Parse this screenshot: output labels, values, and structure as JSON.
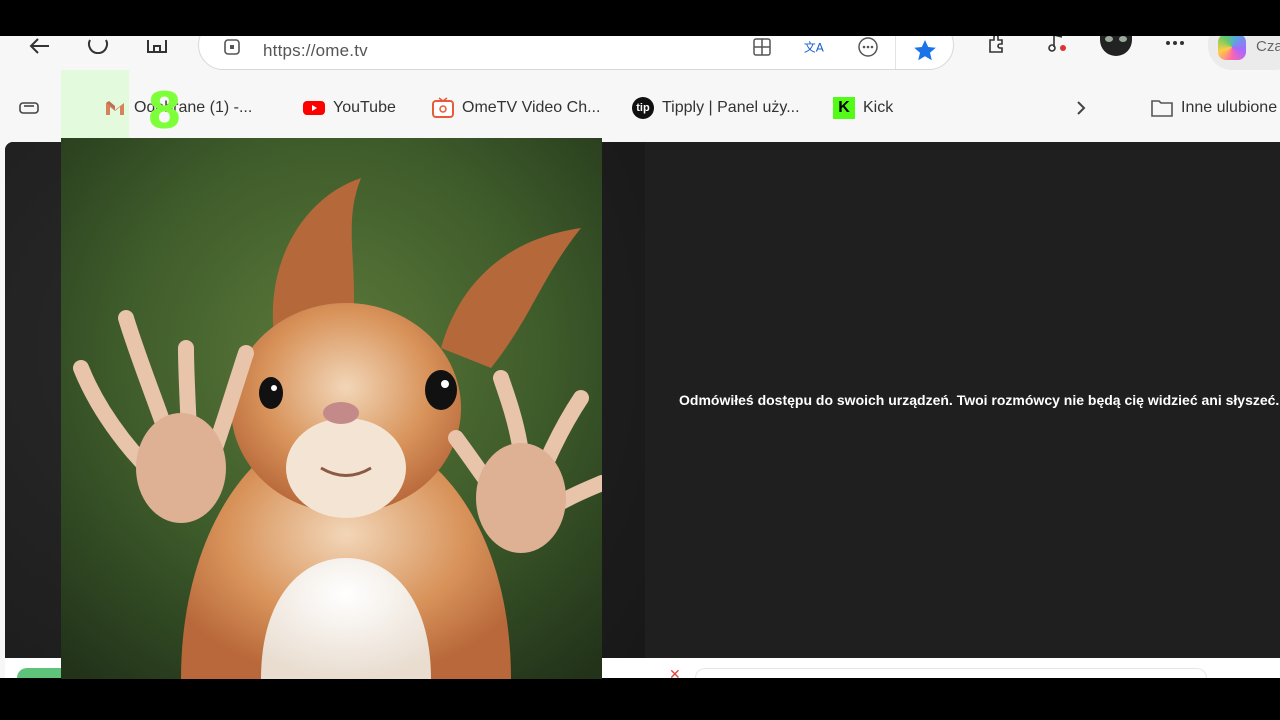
{
  "browser": {
    "address_url": "https://ome.tv",
    "copilot_label": "Cza"
  },
  "bookmarks": {
    "items": [
      {
        "label": "Odebrane (1) -...",
        "icon": "gmail-icon"
      },
      {
        "label": "YouTube",
        "icon": "youtube-icon"
      },
      {
        "label": "OmeTV Video Ch...",
        "icon": "ometv-icon"
      },
      {
        "label": "Tipply | Panel uży...",
        "icon": "tipply-icon"
      },
      {
        "label": "Kick",
        "icon": "kick-icon"
      }
    ],
    "other_favorites": "Inne ulubione"
  },
  "video": {
    "permission_denied_message": "Odmówiłeś dostępu do swoich urządzeń. Twoi rozmówcy nie będą cię widzieć ani słyszeć.",
    "overlay_digit": "8"
  },
  "colors": {
    "stage_bg": "#1e1e1e",
    "accent_star": "#1a73e8",
    "overlay_green": "#7dff3a",
    "youtube_red": "#ff0000",
    "kick_green": "#53fc18"
  }
}
